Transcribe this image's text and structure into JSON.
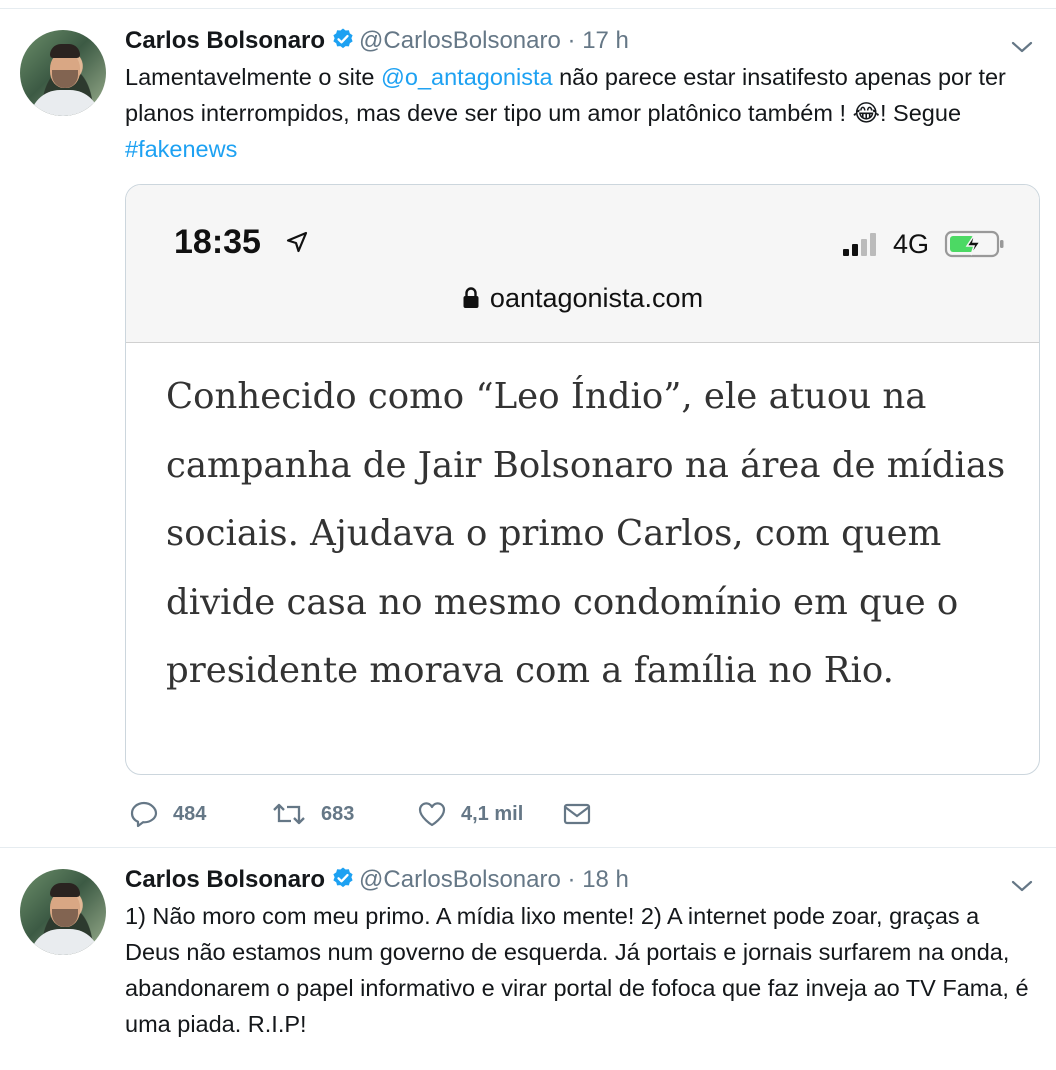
{
  "tweets": [
    {
      "name": "Carlos Bolsonaro",
      "handle": "@CarlosBolsonaro",
      "separator": "·",
      "time": "17 h",
      "text": {
        "p1": "Lamentavelmente o site ",
        "mention": "@o_antagonista",
        "p2": " não parece estar insatifesto apenas por ter planos interrompidos, mas deve ser tipo um amor platônico também ! ",
        "emoji": "😂",
        "p3": "! Segue ",
        "hashtag": "#fakenews"
      },
      "screenshot": {
        "clock": "18:35",
        "network": "4G",
        "url": "oantagonista.com",
        "article": "Conhecido como “Leo Índio”, ele atuou na campanha de Jair Bolsonaro na área de mídias sociais. Ajudava o primo Carlos, com quem divide casa no mesmo condomínio em que o presidente morava com a família no Rio."
      },
      "stats": {
        "replies": "484",
        "retweets": "683",
        "likes": "4,1 mil"
      }
    },
    {
      "name": "Carlos Bolsonaro",
      "handle": "@CarlosBolsonaro",
      "separator": "·",
      "time": "18 h",
      "text": "1) Não moro com meu primo. A mídia lixo mente! 2) A internet pode zoar, graças a Deus não estamos num governo de esquerda. Já portais e jornais surfarem na onda, abandonarem o papel informativo e virar portal de fofoca que faz inveja ao TV Fama, é uma piada. R.I.P!"
    }
  ],
  "icons": {
    "verified": "verified-badge-icon",
    "caret": "chevron-down-icon",
    "reply": "reply-icon",
    "retweet": "retweet-icon",
    "like": "heart-icon",
    "dm": "envelope-icon",
    "location": "location-arrow-icon",
    "lock": "lock-icon",
    "signal": "cellular-signal-icon",
    "battery": "battery-charging-icon"
  },
  "colors": {
    "link": "#1da1f2",
    "muted": "#657786",
    "text": "#14171a",
    "battery": "#4cd964"
  }
}
